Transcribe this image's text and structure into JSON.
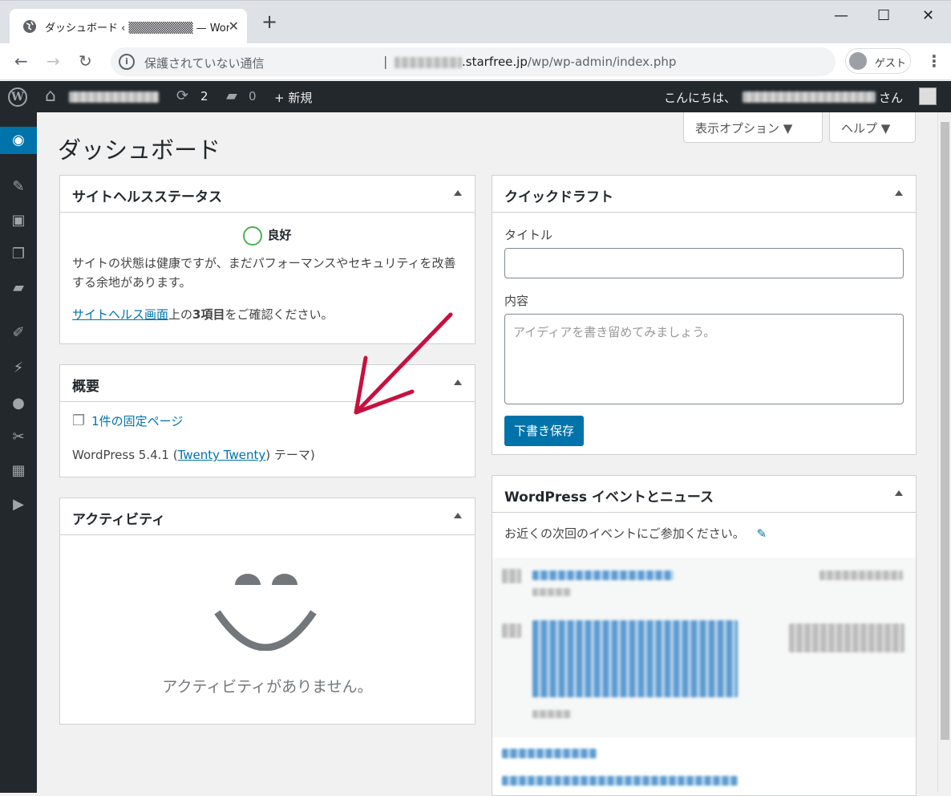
{
  "browser": {
    "tab_title": "ダッシュボード ‹ ▒▒▒▒▒▒▒▒ — Wor",
    "close_glyph": "✕",
    "new_tab_glyph": "+",
    "window_controls": [
      "—",
      "☐",
      "✕"
    ],
    "nav": {
      "back": "←",
      "forward": "→",
      "reload": "↻"
    },
    "info_glyph": "i",
    "not_secure": "保護されていない通信",
    "separator": "|",
    "url_host": ".starfree.jp",
    "url_path": "/wp/wp-admin/index.php",
    "guest_label": "ゲスト",
    "menu_glyph": "⋮"
  },
  "adminbar": {
    "wp_glyph": "W",
    "home_glyph": "⌂",
    "updates_glyph": "⟳",
    "updates_count": "2",
    "comments_glyph": "▰",
    "comments_count": "0",
    "new_label": "+ 新規",
    "greeting_prefix": "こんにちは、",
    "greeting_suffix": "さん"
  },
  "sidebar": {
    "items": [
      {
        "name": "dashboard-icon",
        "glyph": "◉"
      },
      {
        "name": "posts-icon",
        "glyph": "✎"
      },
      {
        "name": "media-icon",
        "glyph": "▣"
      },
      {
        "name": "pages-icon",
        "glyph": "❐"
      },
      {
        "name": "comments-icon",
        "glyph": "▰"
      },
      {
        "name": "appearance-icon",
        "glyph": "✐"
      },
      {
        "name": "plugins-icon",
        "glyph": "⚡"
      },
      {
        "name": "users-icon",
        "glyph": "●"
      },
      {
        "name": "tools-icon",
        "glyph": "✂"
      },
      {
        "name": "settings-icon",
        "glyph": "▦"
      },
      {
        "name": "collapse-icon",
        "glyph": "▶"
      }
    ]
  },
  "page": {
    "title": "ダッシュボード",
    "screen_options": "表示オプション ▼",
    "help": "ヘルプ ▼"
  },
  "site_health": {
    "title": "サイトヘルスステータス",
    "status": "良好",
    "description": "サイトの状態は健康ですが、まだパフォーマンスやセキュリティを改善する余地があります。",
    "link": "サイトヘルス画面",
    "text_mid": "上の",
    "items_bold": "3項目",
    "text_end": "をご確認ください。"
  },
  "at_a_glance": {
    "title": "概要",
    "pages_link": "1件の固定ページ",
    "wp_version": "WordPress 5.4.1 (",
    "theme_link": "Twenty Twenty",
    "theme_suffix": ") テーマ)"
  },
  "activity": {
    "title": "アクティビティ",
    "empty": "アクティビティがありません。"
  },
  "quick_draft": {
    "title": "クイックドラフト",
    "title_label": "タイトル",
    "content_label": "内容",
    "content_placeholder": "アイディアを書き留めてみましょう。",
    "save_button": "下書き保存"
  },
  "events": {
    "title": "WordPress イベントとニュース",
    "intro": "お近くの次回のイベントにご参加ください。",
    "edit_glyph": "✎"
  },
  "colors": {
    "wp_blue": "#0073aa",
    "admin_dark": "#23282d",
    "health_green": "#46b450",
    "annotation_red": "#c8103e"
  }
}
